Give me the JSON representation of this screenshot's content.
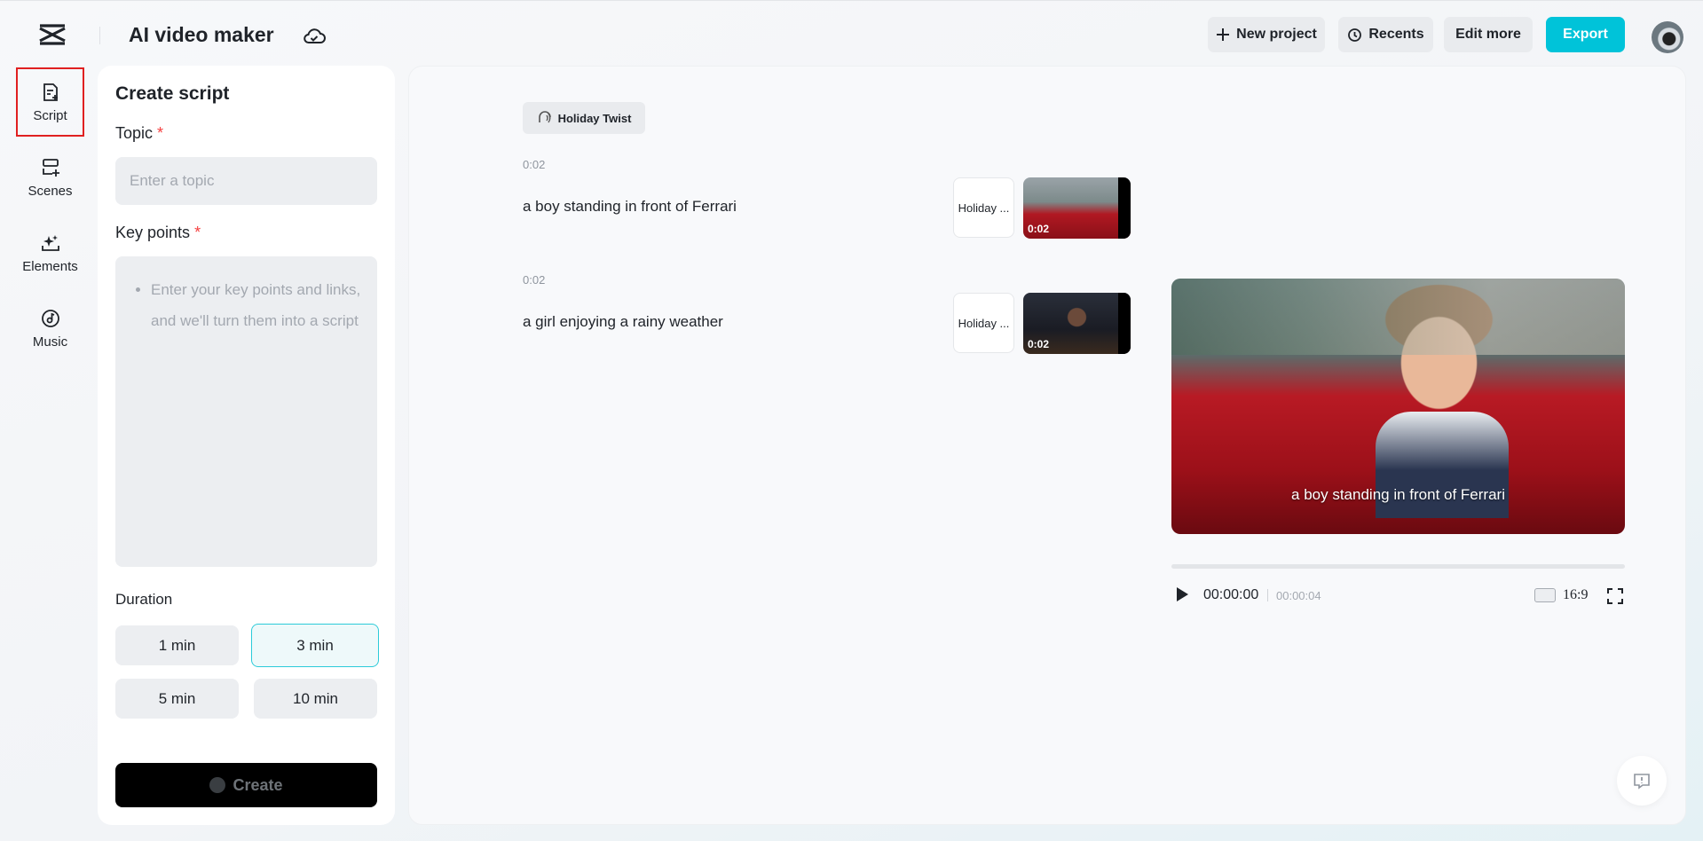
{
  "header": {
    "title": "AI video maker",
    "new_project": "New project",
    "recents": "Recents",
    "edit_more": "Edit more",
    "export": "Export"
  },
  "rail": {
    "script": "Script",
    "scenes": "Scenes",
    "elements": "Elements",
    "music": "Music"
  },
  "panel": {
    "title": "Create script",
    "topic_label": "Topic",
    "topic_placeholder": "Enter a topic",
    "keypoints_label": "Key points",
    "keypoints_placeholder": "Enter your key points and links, and we'll turn them into a script",
    "duration_label": "Duration",
    "durations": [
      "1 min",
      "3 min",
      "5 min",
      "10 min"
    ],
    "selected_duration": "3 min",
    "create": "Create",
    "required_mark": "*"
  },
  "main": {
    "voice": "Holiday Twist",
    "scenes": [
      {
        "time": "0:02",
        "text": "a boy standing in front of Ferrari",
        "voice_card": "Holiday ...",
        "thumb_time": "0:02"
      },
      {
        "time": "0:02",
        "text": "a girl enjoying a rainy weather",
        "voice_card": "Holiday ...",
        "thumb_time": "0:02"
      }
    ],
    "preview": {
      "caption": "a boy standing in front of Ferrari",
      "current_time": "00:00:00",
      "total_time": "00:00:04",
      "aspect_ratio": "16:9",
      "progress": 0
    }
  },
  "colors": {
    "accent": "#00c3d9",
    "required": "#f53f3f",
    "highlight_border": "#e02020"
  }
}
